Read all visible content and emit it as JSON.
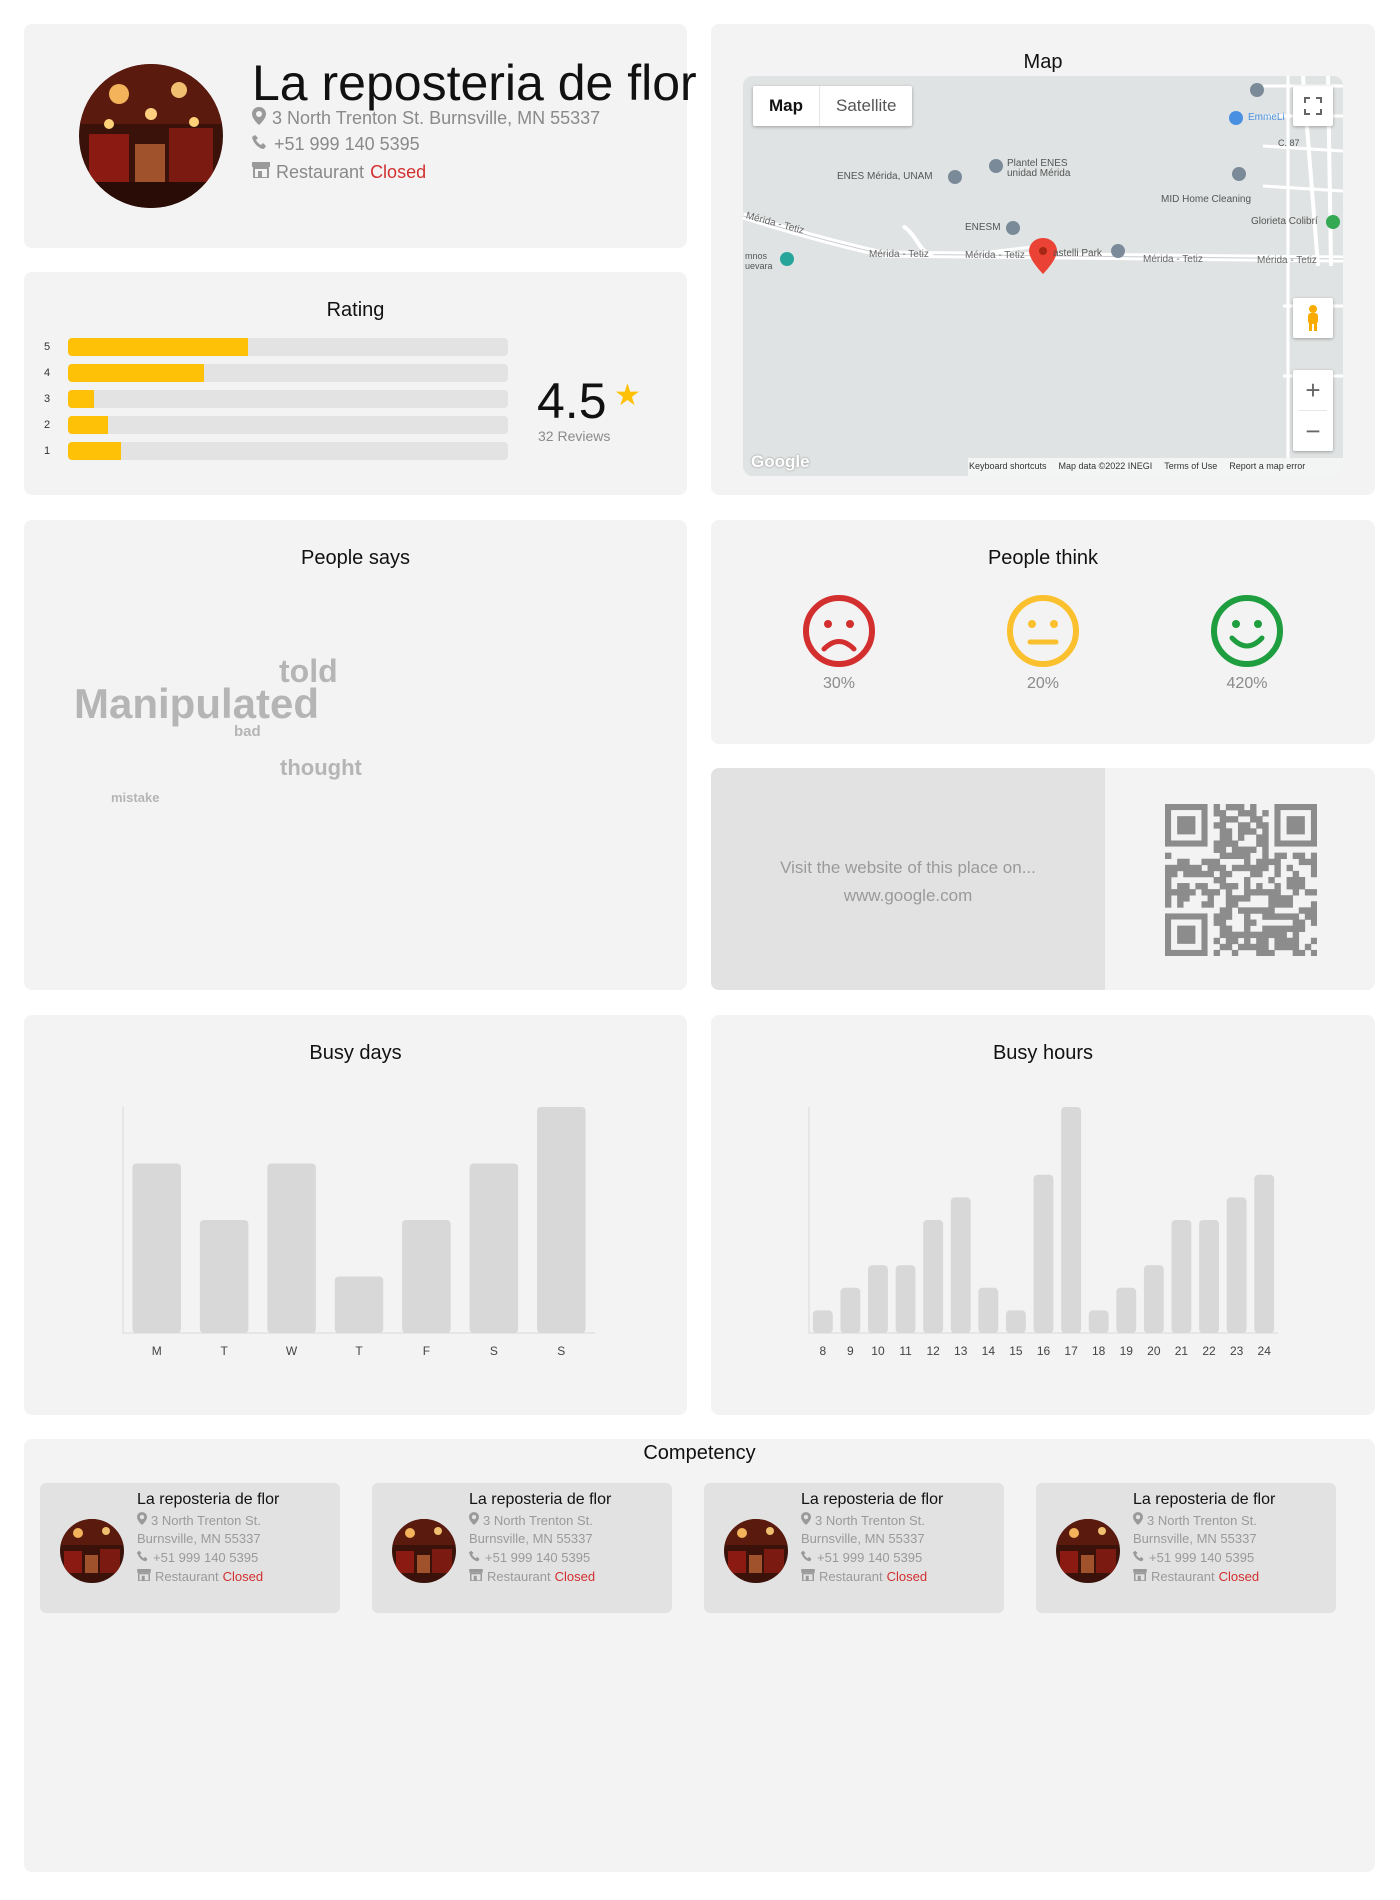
{
  "place": {
    "name": "La reposteria de flor",
    "address": "3 North Trenton St. Burnsville, MN 55337",
    "phone": "+51 999 140 5395",
    "category": "Restaurant",
    "status": "Closed"
  },
  "rating": {
    "title": "Rating",
    "score": "4.5",
    "reviews": "32 Reviews",
    "bars": [
      {
        "label": "5",
        "fraction": 0.41
      },
      {
        "label": "4",
        "fraction": 0.31
      },
      {
        "label": "3",
        "fraction": 0.06
      },
      {
        "label": "2",
        "fraction": 0.09
      },
      {
        "label": "1",
        "fraction": 0.12
      }
    ]
  },
  "map": {
    "title": "Map",
    "type_map": "Map",
    "type_satellite": "Satellite",
    "labels": {
      "unam": "ENES Mérida, UNAM",
      "plantel": "Plantel ENES",
      "plantel2": "unidad Mérida",
      "mid": "MID Home Cleaning",
      "glorieta": "Glorieta Colibrí",
      "enesm": "ENESM",
      "merida1": "Mérida - Tetiz",
      "merida2": "Mérida - Tetiz",
      "merida3": "Mérida - Tetiz",
      "merida4": "Mérida - Tetiz",
      "merida5": "Mérida - Tetiz",
      "castelli": "astelli Park",
      "emme": "EmmeLi",
      "mnos": "mnos",
      "uevara": "uevara",
      "c87": "C. 87"
    },
    "footer": {
      "google": "Google",
      "shortcuts": "Keyboard shortcuts",
      "mapdata": "Map data ©2022 INEGI",
      "terms": "Terms of Use",
      "report": "Report a map error"
    }
  },
  "says": {
    "title": "People says",
    "words": [
      "told",
      "Manipulated",
      "bad",
      "thought",
      "mistake"
    ]
  },
  "think": {
    "title": "People think",
    "sad": "30%",
    "neutral": "20%",
    "happy": "420%",
    "colors": {
      "sad": "#d32f2f",
      "neutral": "#fbc02d",
      "happy": "#1e9e3e"
    }
  },
  "website": {
    "line1": "Visit the website of this place on...",
    "line2": "www.google.com"
  },
  "chart_data": [
    {
      "type": "bar",
      "title": "Busy days",
      "categories": [
        "M",
        "T",
        "W",
        "T",
        "F",
        "S",
        "S"
      ],
      "values": [
        3,
        2,
        3,
        1,
        2,
        3,
        4
      ],
      "ylim": [
        0,
        4
      ]
    },
    {
      "type": "bar",
      "title": "Busy hours",
      "categories": [
        "8",
        "9",
        "10",
        "11",
        "12",
        "13",
        "14",
        "15",
        "16",
        "17",
        "18",
        "19",
        "20",
        "21",
        "22",
        "23",
        "24"
      ],
      "values": [
        1,
        2,
        3,
        3,
        5,
        6,
        2,
        1,
        7,
        10,
        1,
        2,
        3,
        5,
        5,
        6,
        7
      ],
      "ylim": [
        0,
        10
      ]
    }
  ],
  "competency": {
    "title": "Competency",
    "items": [
      {
        "name": "La reposteria de flor",
        "street": "3 North Trenton St.",
        "city": "Burnsville, MN 55337",
        "phone": "+51 999 140 5395",
        "category": "Restaurant",
        "status": "Closed"
      },
      {
        "name": "La reposteria de flor",
        "street": "3 North Trenton St.",
        "city": "Burnsville, MN 55337",
        "phone": "+51 999 140 5395",
        "category": "Restaurant",
        "status": "Closed"
      },
      {
        "name": "La reposteria de flor",
        "street": "3 North Trenton St.",
        "city": "Burnsville, MN 55337",
        "phone": "+51 999 140 5395",
        "category": "Restaurant",
        "status": "Closed"
      },
      {
        "name": "La reposteria de flor",
        "street": "3 North Trenton St.",
        "city": "Burnsville, MN 55337",
        "phone": "+51 999 140 5395",
        "category": "Restaurant",
        "status": "Closed"
      }
    ]
  }
}
